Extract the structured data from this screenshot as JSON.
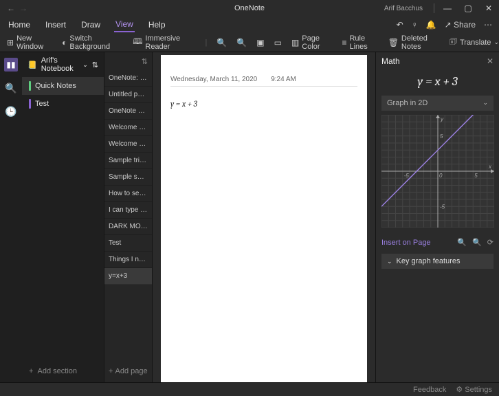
{
  "titlebar": {
    "app_name": "OneNote",
    "user_name": "Arif Bacchus"
  },
  "menubar": {
    "items": [
      "Home",
      "Insert",
      "Draw",
      "View",
      "Help"
    ],
    "active_index": 3,
    "share_label": "Share"
  },
  "ribbon": {
    "new_window": "New Window",
    "switch_bg": "Switch Background",
    "immersive": "Immersive Reader",
    "page_color": "Page Color",
    "rule_lines": "Rule Lines",
    "deleted_notes": "Deleted Notes",
    "translate": "Translate"
  },
  "notebook": {
    "name": "Arif's Notebook",
    "sections": [
      {
        "label": "Quick Notes",
        "color": "#5fcf80",
        "selected": true
      },
      {
        "label": "Test",
        "color": "#8a63d2",
        "selected": false
      }
    ],
    "add_section": "Add section"
  },
  "pages": {
    "items": [
      "OneNote: one…",
      "Untitled page",
      "OneNote Basics",
      "Welcome to O…",
      "Welcome to O…",
      "Sample trip pl…",
      "Sample shopp…",
      "How to set up…",
      "I can type on…",
      "DARK MODE…",
      "Test",
      "Things I need…",
      "y=x+3"
    ],
    "selected_index": 12,
    "add_page": "Add page"
  },
  "canvas": {
    "date": "Wednesday, March 11, 2020",
    "time": "9:24 AM",
    "equation": "y = x + 3"
  },
  "math_panel": {
    "title": "Math",
    "equation_display": "y = x + 3",
    "graph_mode": "Graph in 2D",
    "insert_label": "Insert on Page",
    "key_features": "Key graph features"
  },
  "footer": {
    "feedback": "Feedback",
    "settings": "Settings"
  },
  "chart_data": {
    "type": "line",
    "title": "",
    "xlabel": "x",
    "ylabel": "y",
    "xlim": [
      -8,
      8
    ],
    "ylim": [
      -8,
      8
    ],
    "x_ticks": [
      -5,
      0,
      5
    ],
    "y_ticks": [
      -5,
      0,
      5
    ],
    "series": [
      {
        "name": "y = x + 3",
        "x": [
          -8,
          8
        ],
        "y": [
          -5,
          11
        ]
      }
    ]
  }
}
